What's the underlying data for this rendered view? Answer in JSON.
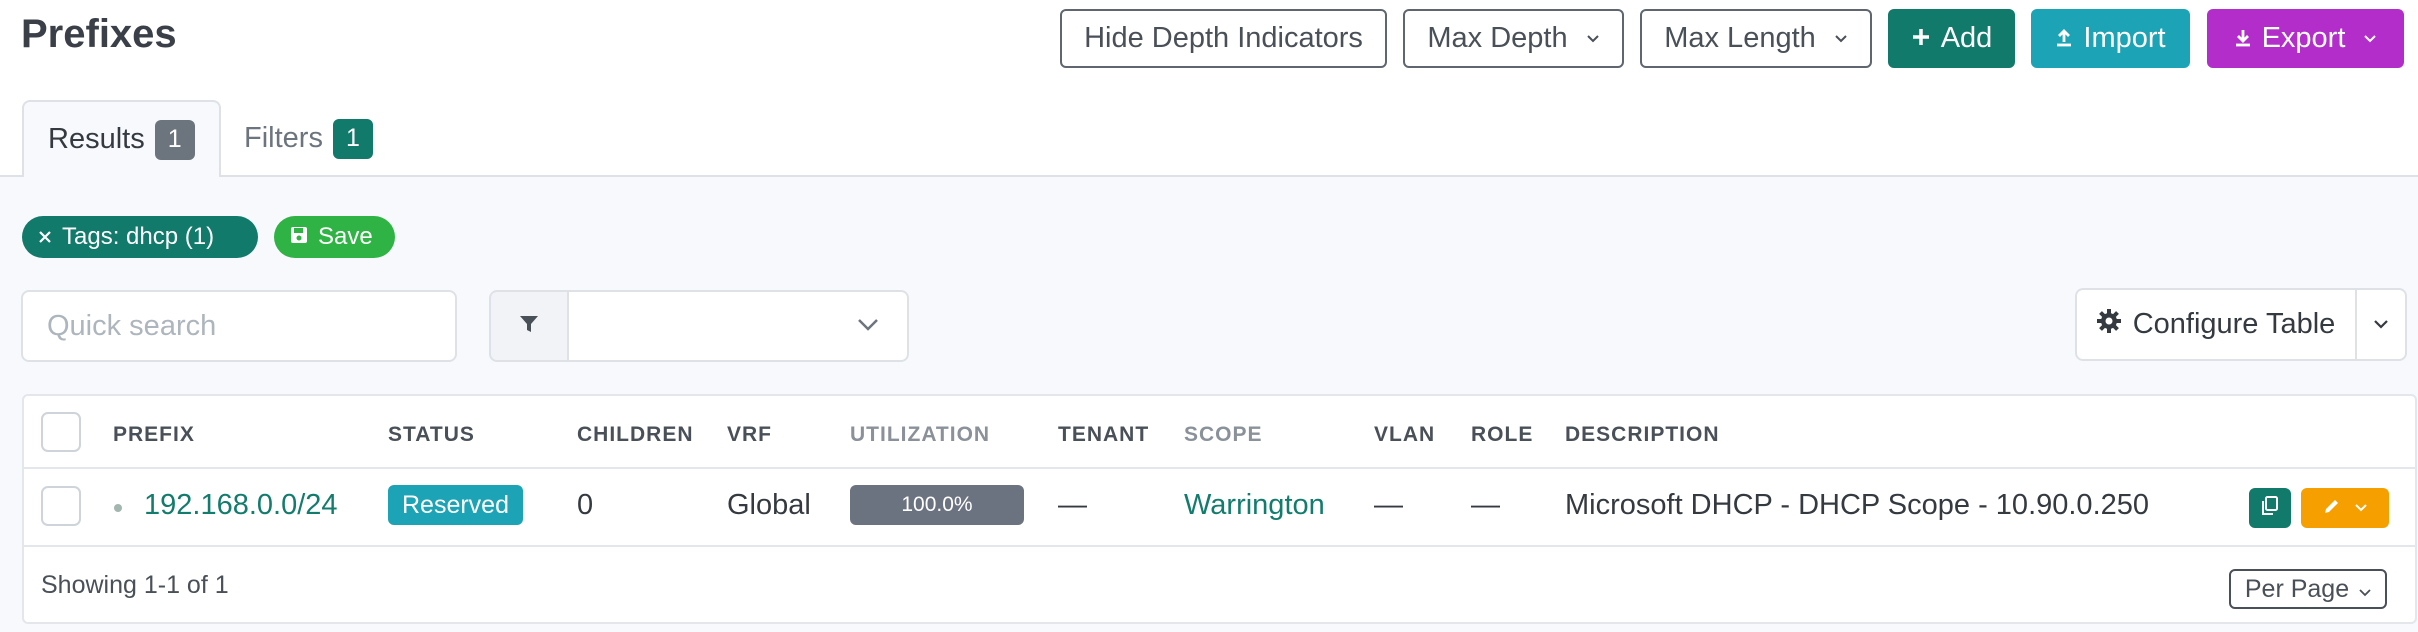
{
  "page": {
    "title": "Prefixes"
  },
  "header_buttons": {
    "hide_depth": "Hide Depth Indicators",
    "max_depth": "Max Depth",
    "max_length": "Max Length",
    "add": "Add",
    "import": "Import",
    "export": "Export"
  },
  "tabs": [
    {
      "label": "Results",
      "count": "1"
    },
    {
      "label": "Filters",
      "count": "1"
    }
  ],
  "active_filters": [
    {
      "label": "Tags: dhcp (1)"
    }
  ],
  "save_label": "Save",
  "search": {
    "placeholder": "Quick search",
    "value": ""
  },
  "configure_table_label": "Configure Table",
  "table": {
    "columns": [
      "PREFIX",
      "STATUS",
      "CHILDREN",
      "VRF",
      "UTILIZATION",
      "TENANT",
      "SCOPE",
      "VLAN",
      "ROLE",
      "DESCRIPTION"
    ],
    "rows": [
      {
        "prefix": "192.168.0.0/24",
        "status": "Reserved",
        "children": "0",
        "vrf": "Global",
        "utilization": "100.0%",
        "tenant": "—",
        "scope": "Warrington",
        "vlan": "—",
        "role": "—",
        "description": "Microsoft DHCP - DHCP Scope - 10.90.0.250"
      }
    ]
  },
  "footer": {
    "showing": "Showing 1-1 of 1",
    "per_page_label": "Per Page"
  },
  "colors": {
    "teal": "#117a6b",
    "cyan": "#1ca3b5",
    "purple": "#b22dc9",
    "green": "#2fb344",
    "orange": "#f59f00",
    "gray_badge": "#6c757d"
  }
}
